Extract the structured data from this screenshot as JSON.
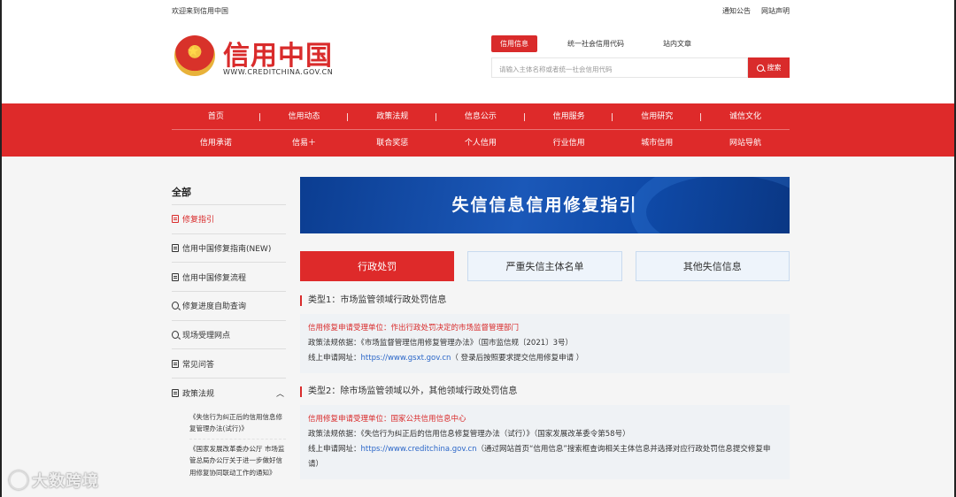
{
  "topbar": {
    "welcome": "欢迎来到信用中国",
    "links": [
      "通知公告",
      "网站声明"
    ]
  },
  "header": {
    "logo_title": "信用中国",
    "logo_url": "WWW.CREDITCHINA.GOV.CN",
    "search_tabs": [
      "信用信息",
      "统一社会信用代码",
      "站内文章"
    ],
    "search_placeholder": "请输入主体名称或者统一社会信用代码",
    "search_button": "搜索"
  },
  "nav": {
    "row1": [
      "首页",
      "信用动态",
      "政策法规",
      "信息公示",
      "信用服务",
      "信用研究",
      "诚信文化"
    ],
    "row2": [
      "信用承诺",
      "信易＋",
      "联合奖惩",
      "个人信用",
      "行业信用",
      "城市信用",
      "网站导航"
    ]
  },
  "sidebar": {
    "title": "全部",
    "items": [
      {
        "label": "修复指引",
        "icon": "document-icon"
      },
      {
        "label": "信用中国修复指南(NEW)",
        "icon": "document-icon"
      },
      {
        "label": "信用中国修复流程",
        "icon": "document-icon"
      },
      {
        "label": "修复进度自助查询",
        "icon": "search-icon"
      },
      {
        "label": "现场受理网点",
        "icon": "search-icon"
      },
      {
        "label": "常见问答",
        "icon": "document-icon"
      },
      {
        "label": "政策法规",
        "icon": "document-icon"
      }
    ],
    "sub_items": [
      "《失信行为纠正后的信用信息修复管理办法(试行)》",
      "《国家发展改革委办公厅 市场监管总局办公厅关于进一步做好信用修复协同联动工作的通知》"
    ]
  },
  "main": {
    "banner": "失信信息信用修复指引",
    "tabs": [
      "行政处罚",
      "严重失信主体名单",
      "其他失信信息"
    ],
    "type1": {
      "heading": "类型1：市场监管领域行政处罚信息",
      "unit_label": "信用修复申请受理单位：作出行政处罚决定的市场监督管理部门",
      "basis": "政策法规依据：《市场监督管理信用修复管理办法》（国市监信规〔2021〕3号）",
      "online_prefix": "线上申请网址：",
      "online_url": "https://www.gsxt.gov.cn",
      "online_suffix": "（ 登录后按照要求提交信用修复申请 ）"
    },
    "type2": {
      "heading": "类型2：除市场监管领域以外，其他领域行政处罚信息",
      "unit_label": "信用修复申请受理单位：国家公共信用信息中心",
      "basis": "政策法规依据：《失信行为纠正后的信用信息修复管理办法（试行）》（国家发展改革委令第58号）",
      "online_prefix": "线上申请网址：",
      "online_url": "https://www.creditchina.gov.cn",
      "online_suffix": "（通过网站首页“信用信息”搜索框查询相关主体信息并选择对应行政处罚信息提交修复申请）"
    }
  },
  "watermark": "大数跨境",
  "colors": {
    "brand_red": "#de2a2a",
    "banner_blue": "#1b58b8",
    "link_blue": "#2a66c8"
  }
}
